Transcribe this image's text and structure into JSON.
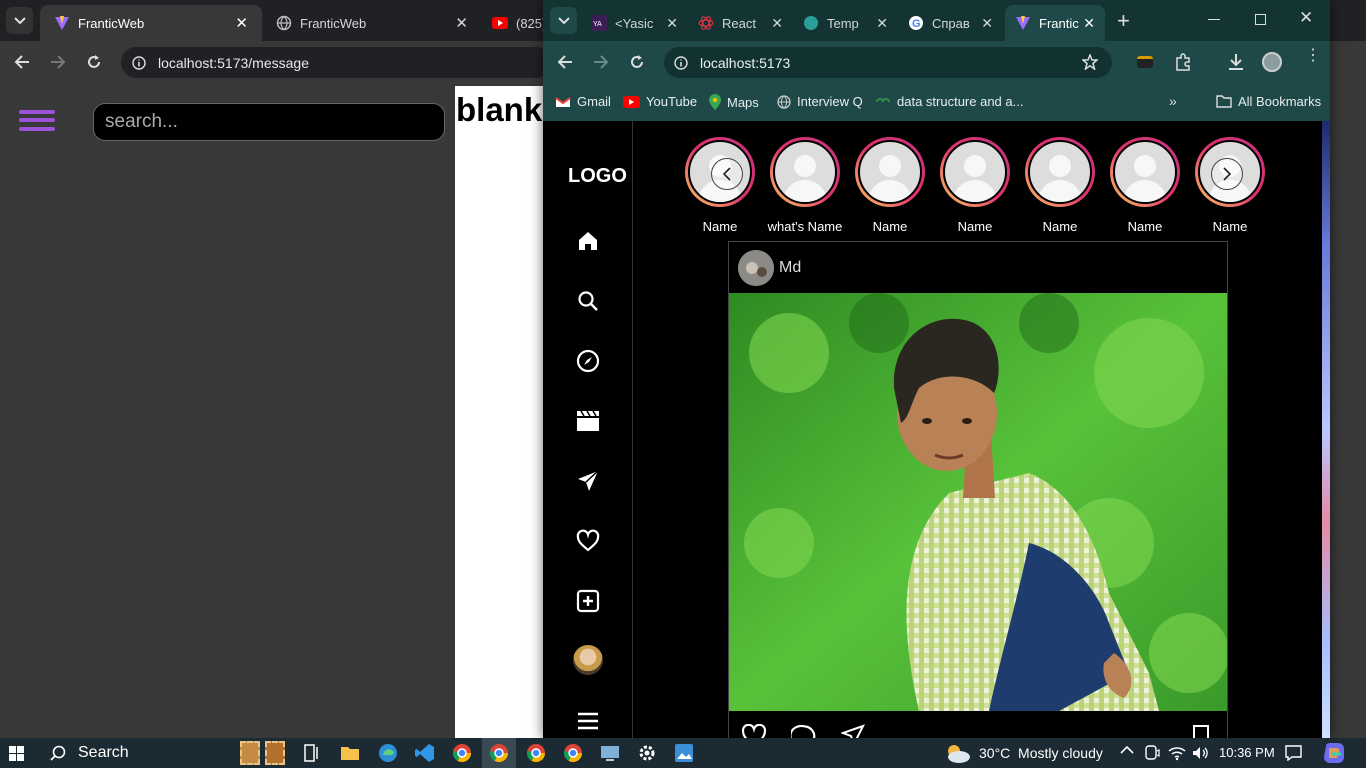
{
  "back_window": {
    "tabs": [
      {
        "title": "FranticWeb",
        "active": true
      },
      {
        "title": "FranticWeb",
        "active": false
      },
      {
        "title": "(825)",
        "active": false
      }
    ],
    "url": "localhost:5173/message",
    "search_placeholder": "search...",
    "blank_text": "blank"
  },
  "front_window": {
    "tabs": [
      {
        "title": "<Yasic",
        "active": false
      },
      {
        "title": "React",
        "active": false
      },
      {
        "title": "Temp",
        "active": false
      },
      {
        "title": "Справ",
        "active": false
      },
      {
        "title": "Frantic",
        "active": true
      }
    ],
    "url": "localhost:5173",
    "bookmarks": [
      "Gmail",
      "YouTube",
      "Maps",
      "Interview Q",
      "data structure and a..."
    ],
    "all_bookmarks": "All Bookmarks",
    "app": {
      "logo": "LOGO",
      "sidebar_icons": [
        "home-icon",
        "search-icon",
        "compass-icon",
        "clapperboard-icon",
        "send-icon",
        "heart-icon",
        "plus-square-icon",
        "avatar",
        "menu-icon"
      ],
      "stories": [
        "Name",
        "what's Name",
        "Name",
        "Name",
        "Name",
        "Name",
        "Name"
      ],
      "post": {
        "author": "Md"
      }
    }
  },
  "taskbar": {
    "search_label": "Search",
    "weather": "30°C  Mostly cloudy",
    "time": "10:36 PM"
  },
  "colors": {
    "accent": "#9c52d8",
    "story_ring": "#e1306c"
  }
}
